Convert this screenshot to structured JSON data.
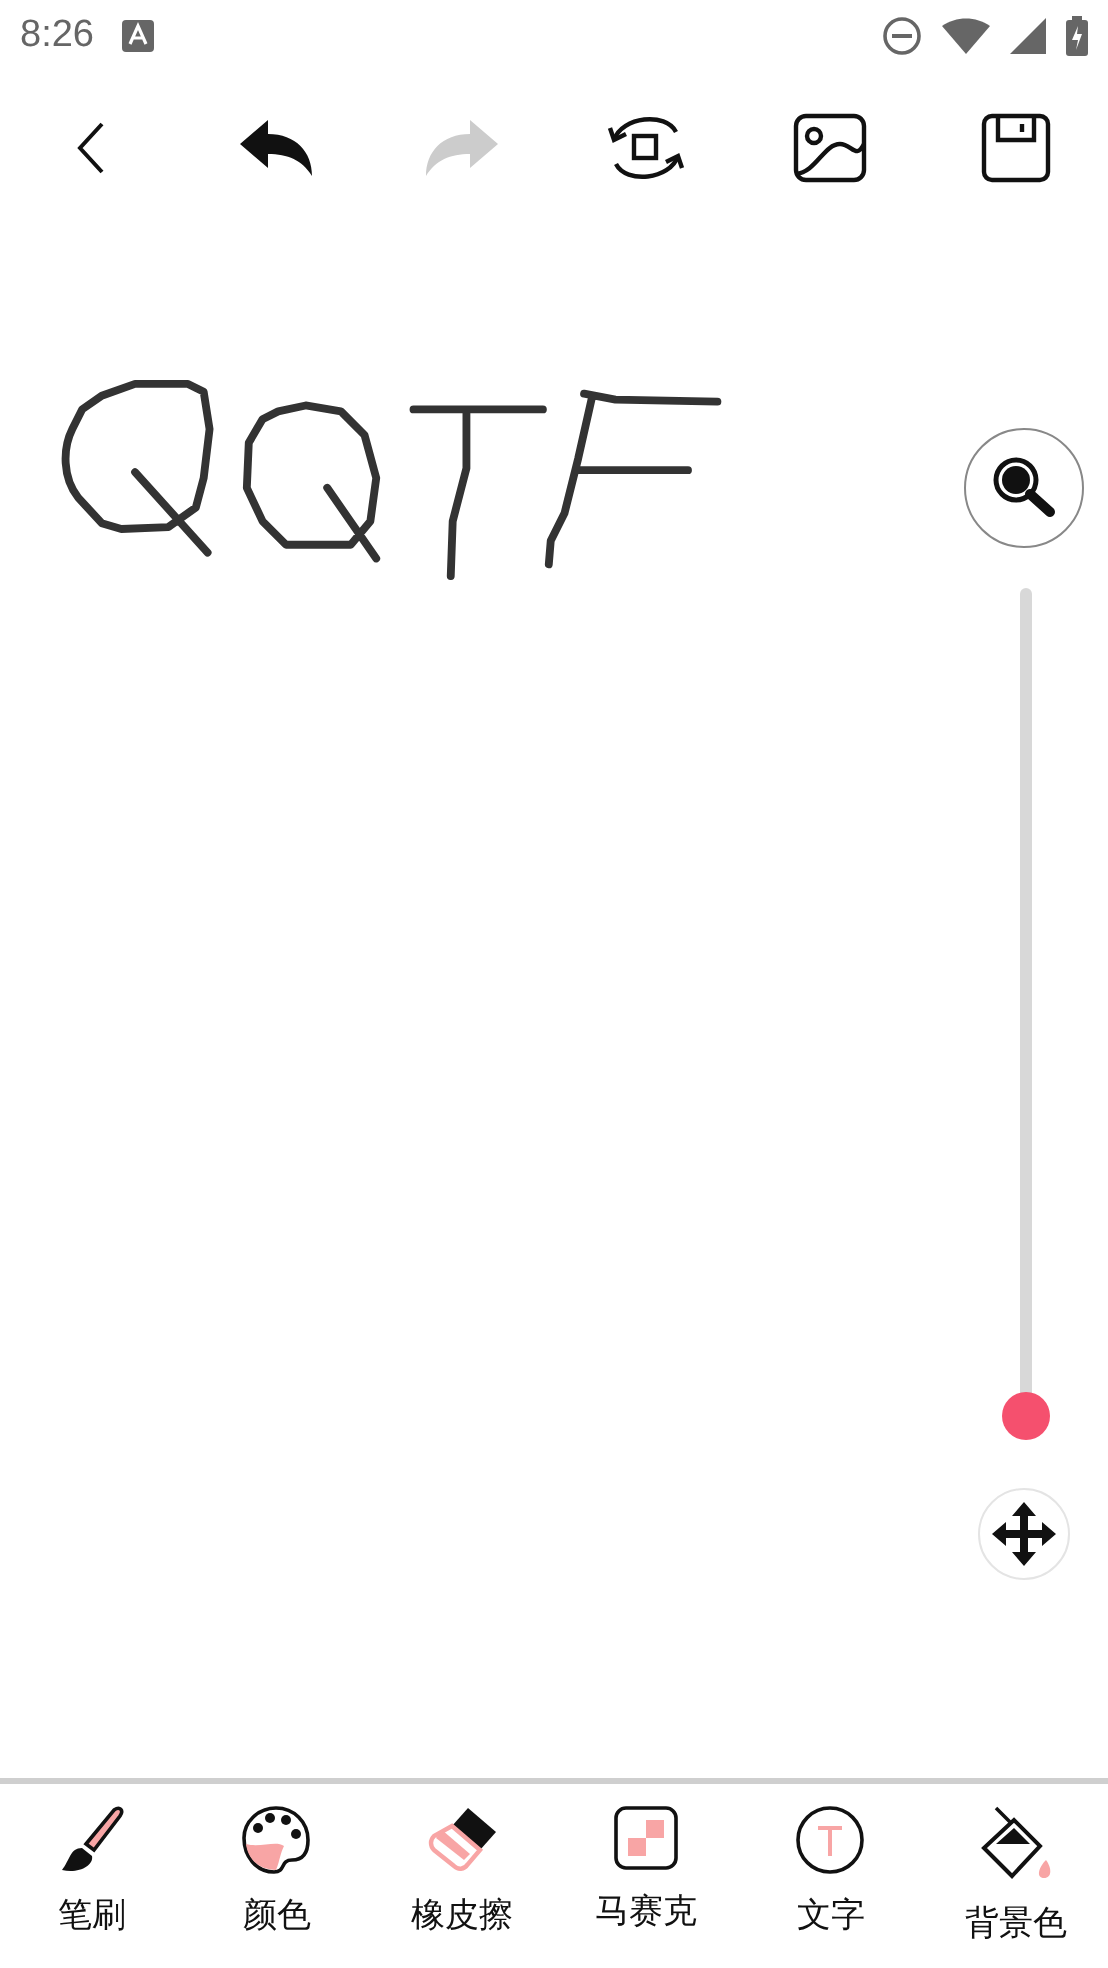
{
  "status_bar": {
    "time": "8:26"
  },
  "toolbar": [
    {
      "kind": "back",
      "disabled": false
    },
    {
      "kind": "undo",
      "disabled": false
    },
    {
      "kind": "redo",
      "disabled": true
    },
    {
      "kind": "rotate",
      "disabled": false
    },
    {
      "kind": "image",
      "disabled": false
    },
    {
      "kind": "save",
      "disabled": false
    }
  ],
  "brush_size_slider": {
    "level": 0
  },
  "tools": [
    {
      "kind": "brush",
      "label": "笔刷"
    },
    {
      "kind": "palette",
      "label": "颜色"
    },
    {
      "kind": "eraser",
      "label": "橡皮擦"
    },
    {
      "kind": "mosaic",
      "label": "马赛克"
    },
    {
      "kind": "text",
      "label": "文字"
    },
    {
      "kind": "fill",
      "label": "背景色"
    }
  ]
}
